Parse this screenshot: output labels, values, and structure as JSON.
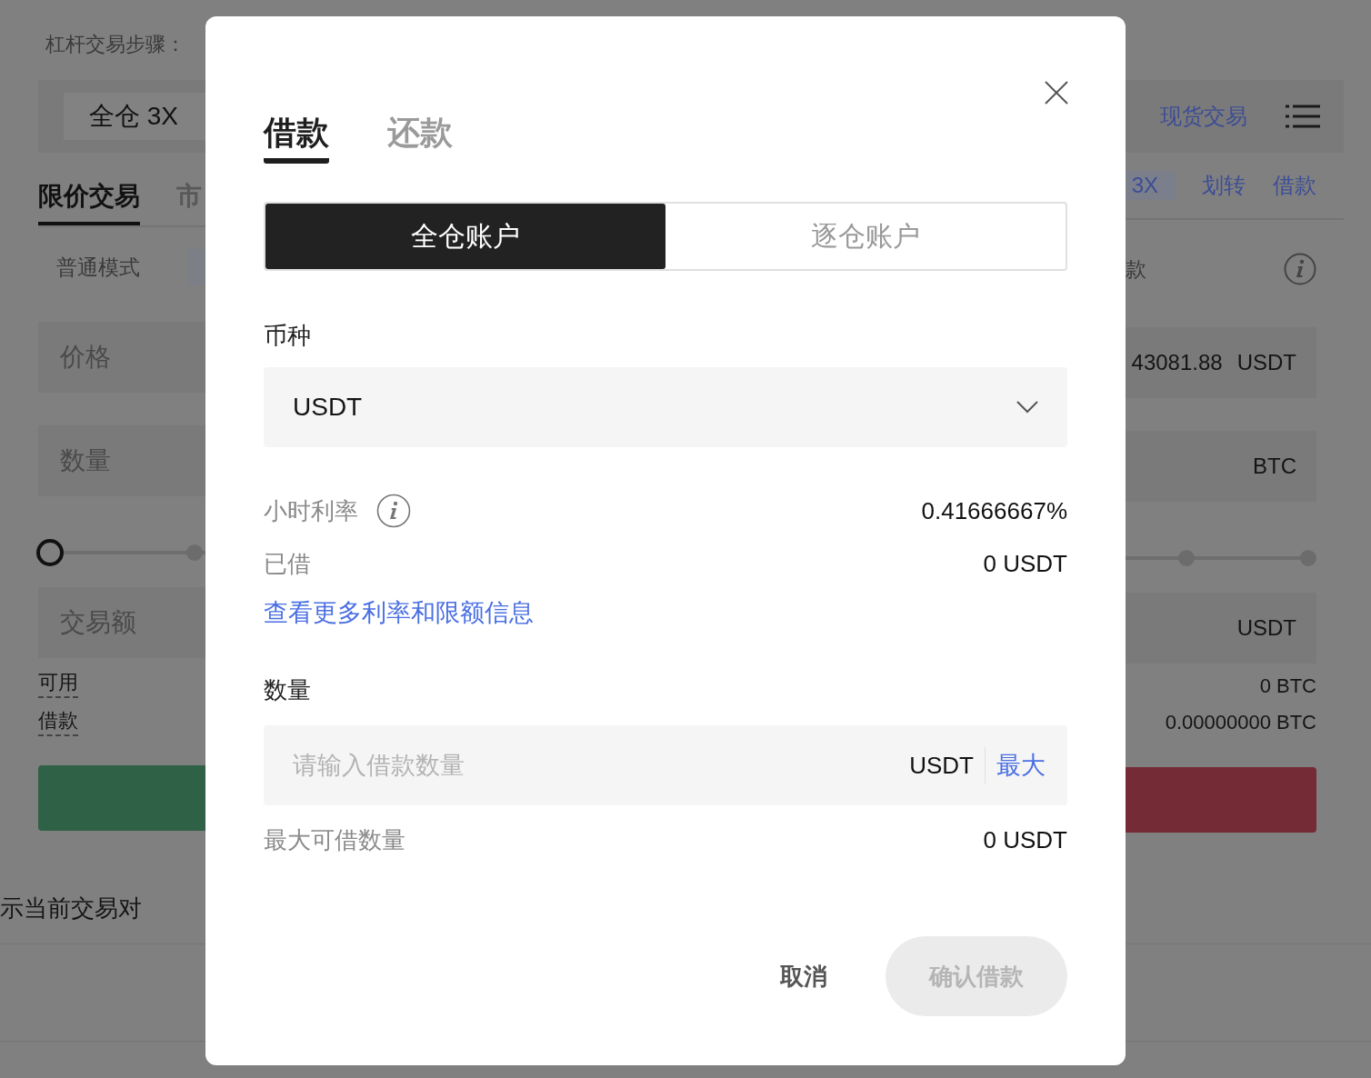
{
  "background": {
    "steps_label": "杠杆交易步骤：",
    "margin_mode": "全仓 3X",
    "order_tabs": [
      {
        "label": "限价交易",
        "selected": true
      },
      {
        "label": "市",
        "selected": false
      }
    ],
    "mode_label": "普通模式",
    "price_placeholder": "价格",
    "amount_placeholder": "数量",
    "total_placeholder": "交易额",
    "slider": {
      "level": 0
    },
    "available_label": "可用",
    "borrowed_label": "借款",
    "pair_note": "示当前交易对",
    "spot_link": "现货交易",
    "leverage_chip": "3X",
    "transfer_link": "划转",
    "borrow_link": "借款",
    "right_label": "款",
    "price_value": "43081.88",
    "price_unit": "USDT",
    "amount_unit": "BTC",
    "total_unit": "USDT",
    "available_value": "0 BTC",
    "borrowed_value": "0.00000000 BTC"
  },
  "dialog": {
    "tabs": [
      {
        "label": "借款",
        "selected": true
      },
      {
        "label": "还款",
        "selected": false
      }
    ],
    "account_types": [
      {
        "label": "全仓账户",
        "selected": true
      },
      {
        "label": "逐仓账户",
        "selected": false
      }
    ],
    "currency": {
      "label": "币种",
      "value": "USDT"
    },
    "rows": [
      {
        "label": "小时利率",
        "value": "0.41666667%",
        "kind": "info"
      },
      {
        "label": "已借",
        "value": "0 USDT",
        "kind": "plain"
      }
    ],
    "more_link": "查看更多利率和限额信息",
    "amount": {
      "label": "数量",
      "placeholder": "请输入借款数量",
      "unit": "USDT",
      "max_button": "最大"
    },
    "max_borrow": {
      "label": "最大可借数量",
      "value": "0 USDT"
    },
    "cancel": "取消",
    "confirm": {
      "label": "确认借款",
      "disabled": true
    }
  }
}
